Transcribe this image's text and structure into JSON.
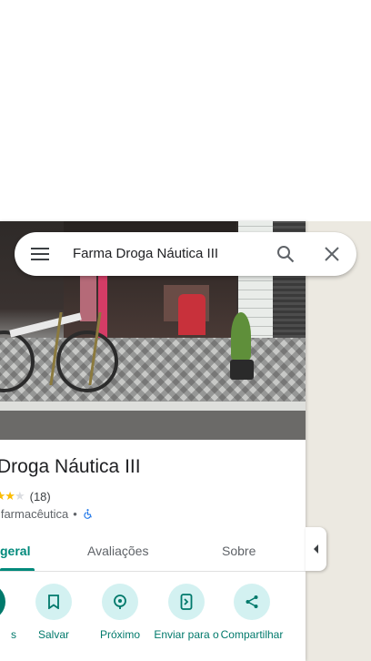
{
  "search": {
    "query": "Farma Droga Náutica III",
    "menu_icon": "menu-icon",
    "search_icon": "search-icon",
    "close_icon": "close-icon"
  },
  "place": {
    "name_visible": "ma Droga Náutica III",
    "rating_stars": 3.5,
    "review_count": "(18)",
    "category_visible": "a farmacêutica",
    "separator": "•",
    "accessibility_icon": "wheelchair-icon"
  },
  "tabs": [
    {
      "label": "geral",
      "active": true
    },
    {
      "label": "Avaliações",
      "active": false
    },
    {
      "label": "Sobre",
      "active": false
    }
  ],
  "actions": [
    {
      "label": "s",
      "icon": "directions-icon"
    },
    {
      "label": "Salvar",
      "icon": "bookmark-icon"
    },
    {
      "label": "Próximo",
      "icon": "nearby-icon"
    },
    {
      "label": "Enviar para o",
      "icon": "send-to-phone-icon"
    },
    {
      "label": "Compartilhar",
      "icon": "share-icon"
    }
  ],
  "colors": {
    "accent": "#00796b",
    "action_bg": "#d3f1f1",
    "star": "#fbbc04"
  },
  "side_toggle_icon": "collapse-left-icon"
}
